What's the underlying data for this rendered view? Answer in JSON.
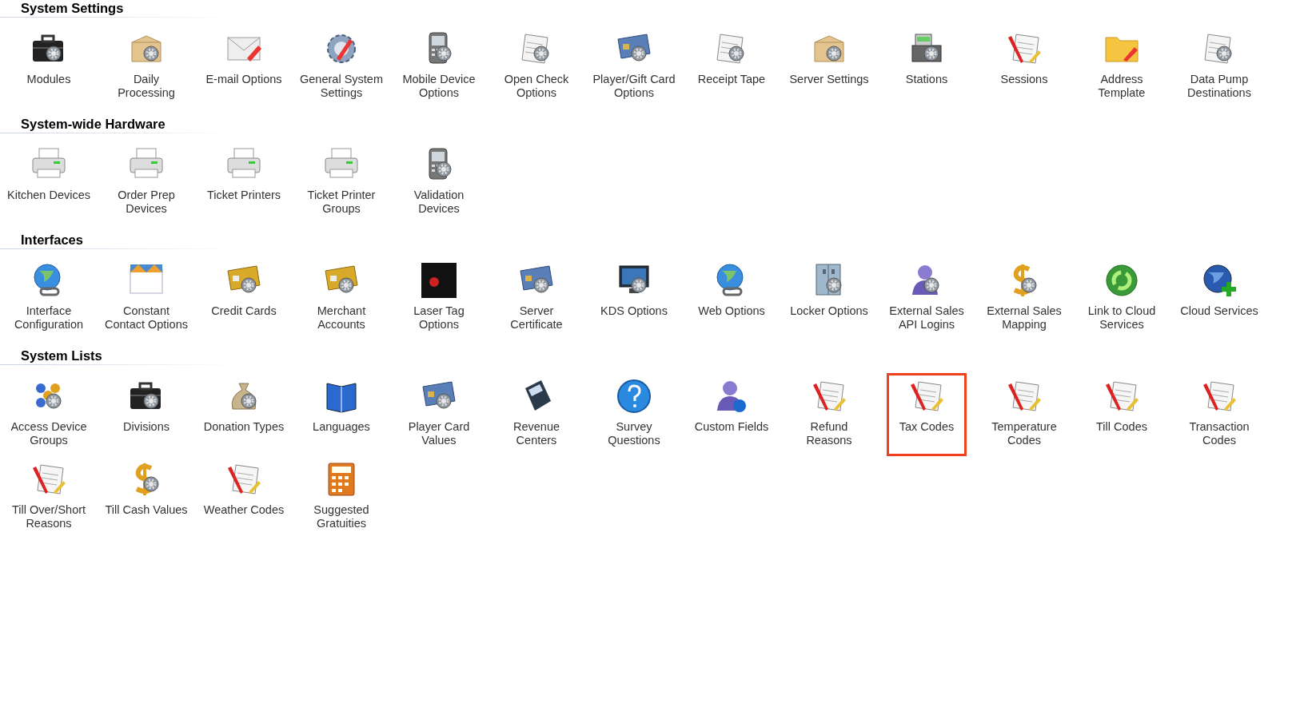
{
  "sections": [
    {
      "title": "System Settings",
      "items": [
        {
          "label": "Modules",
          "selected": false
        },
        {
          "label": "Daily\nProcessing",
          "selected": false
        },
        {
          "label": "E-mail Options",
          "selected": false
        },
        {
          "label": "General System\nSettings",
          "selected": false
        },
        {
          "label": "Mobile Device\nOptions",
          "selected": false
        },
        {
          "label": "Open Check\nOptions",
          "selected": false
        },
        {
          "label": "Player/Gift Card\nOptions",
          "selected": false
        },
        {
          "label": "Receipt Tape",
          "selected": false
        },
        {
          "label": "Server Settings",
          "selected": false
        },
        {
          "label": "Stations",
          "selected": false
        },
        {
          "label": "Sessions",
          "selected": false
        },
        {
          "label": "Address\nTemplate",
          "selected": false
        },
        {
          "label": "Data Pump\nDestinations",
          "selected": false
        }
      ]
    },
    {
      "title": "System-wide Hardware",
      "items": [
        {
          "label": "Kitchen Devices",
          "selected": false
        },
        {
          "label": "Order Prep\nDevices",
          "selected": false
        },
        {
          "label": "Ticket Printers",
          "selected": false
        },
        {
          "label": "Ticket Printer\nGroups",
          "selected": false
        },
        {
          "label": "Validation\nDevices",
          "selected": false
        }
      ]
    },
    {
      "title": "Interfaces",
      "items": [
        {
          "label": "Interface\nConfiguration",
          "selected": false
        },
        {
          "label": "Constant\nContact Options",
          "selected": false
        },
        {
          "label": "Credit Cards",
          "selected": false
        },
        {
          "label": "Merchant\nAccounts",
          "selected": false
        },
        {
          "label": "Laser Tag\nOptions",
          "selected": false
        },
        {
          "label": "Server\nCertificate",
          "selected": false
        },
        {
          "label": "KDS Options",
          "selected": false
        },
        {
          "label": "Web Options",
          "selected": false
        },
        {
          "label": "Locker Options",
          "selected": false
        },
        {
          "label": "External Sales\nAPI Logins",
          "selected": false
        },
        {
          "label": "External Sales\nMapping",
          "selected": false
        },
        {
          "label": "Link to Cloud\nServices",
          "selected": false
        },
        {
          "label": "Cloud Services",
          "selected": false
        }
      ]
    },
    {
      "title": "System Lists",
      "items": [
        {
          "label": "Access Device\nGroups",
          "selected": false
        },
        {
          "label": "Divisions",
          "selected": false
        },
        {
          "label": "Donation Types",
          "selected": false
        },
        {
          "label": "Languages",
          "selected": false
        },
        {
          "label": "Player Card\nValues",
          "selected": false
        },
        {
          "label": "Revenue\nCenters",
          "selected": false
        },
        {
          "label": "Survey\nQuestions",
          "selected": false
        },
        {
          "label": "Custom Fields",
          "selected": false
        },
        {
          "label": "Refund\nReasons",
          "selected": false
        },
        {
          "label": "Tax Codes",
          "selected": true
        },
        {
          "label": "Temperature\nCodes",
          "selected": false
        },
        {
          "label": "Till Codes",
          "selected": false
        },
        {
          "label": "Transaction\nCodes",
          "selected": false
        },
        {
          "label": "Till Over/Short\nReasons",
          "selected": false
        },
        {
          "label": "Till Cash Values",
          "selected": false
        },
        {
          "label": "Weather Codes",
          "selected": false
        },
        {
          "label": "Suggested\nGratuities",
          "selected": false
        }
      ]
    }
  ]
}
